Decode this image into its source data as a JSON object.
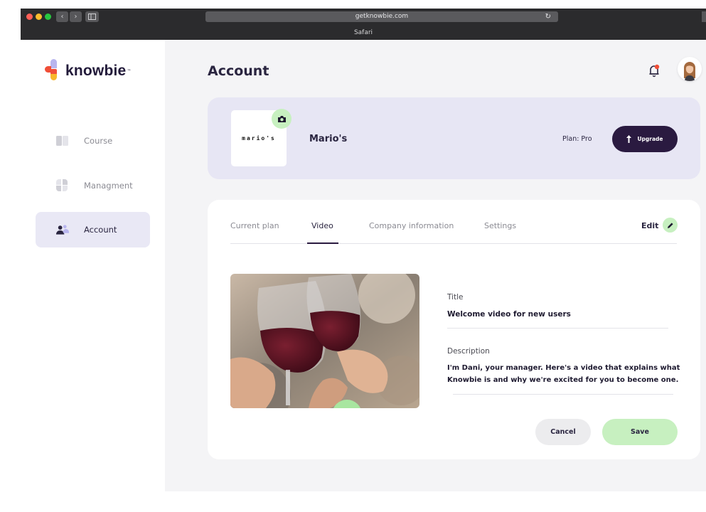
{
  "browser": {
    "url": "getknowbie.com",
    "tab_title": "Safari",
    "back_icon": "chevron-left-icon",
    "forward_icon": "chevron-right-icon",
    "sidebar_toggle_icon": "sidebar-icon",
    "reload_icon": "reload-icon"
  },
  "brand": {
    "name": "knowbie",
    "colors": {
      "purple": "#b8b5ee",
      "red": "#f04e37",
      "yellow": "#f8b62a",
      "dark": "#2a1a40",
      "green": "#c7f0c0"
    }
  },
  "sidebar": {
    "items": [
      {
        "label": "Course",
        "icon": "book-icon",
        "active": false
      },
      {
        "label": "Managment",
        "icon": "grid-icon",
        "active": false
      },
      {
        "label": "Account",
        "icon": "users-icon",
        "active": true
      }
    ]
  },
  "header": {
    "title": "Account",
    "notification_icon": "bell-icon",
    "avatar": "user-avatar"
  },
  "company": {
    "logo_text": "mario's",
    "name": "Mario's",
    "plan": "Plan: Pro",
    "upgrade_label": "Upgrade",
    "camera_icon": "camera-icon"
  },
  "tabs": [
    {
      "label": "Current plan",
      "active": false
    },
    {
      "label": "Video",
      "active": true
    },
    {
      "label": "Company information",
      "active": false
    },
    {
      "label": "Settings",
      "active": false
    }
  ],
  "edit": {
    "label": "Edit",
    "icon": "pencil-icon"
  },
  "video_form": {
    "title_label": "Title",
    "title_value": "Welcome video for new users",
    "description_label": "Description",
    "description_line1": "I'm Dani, your manager. Here's a video that explains what",
    "description_line2": "Knowbie is and why we're excited for you to become one."
  },
  "actions": {
    "cancel_label": "Cancel",
    "save_label": "Save"
  }
}
